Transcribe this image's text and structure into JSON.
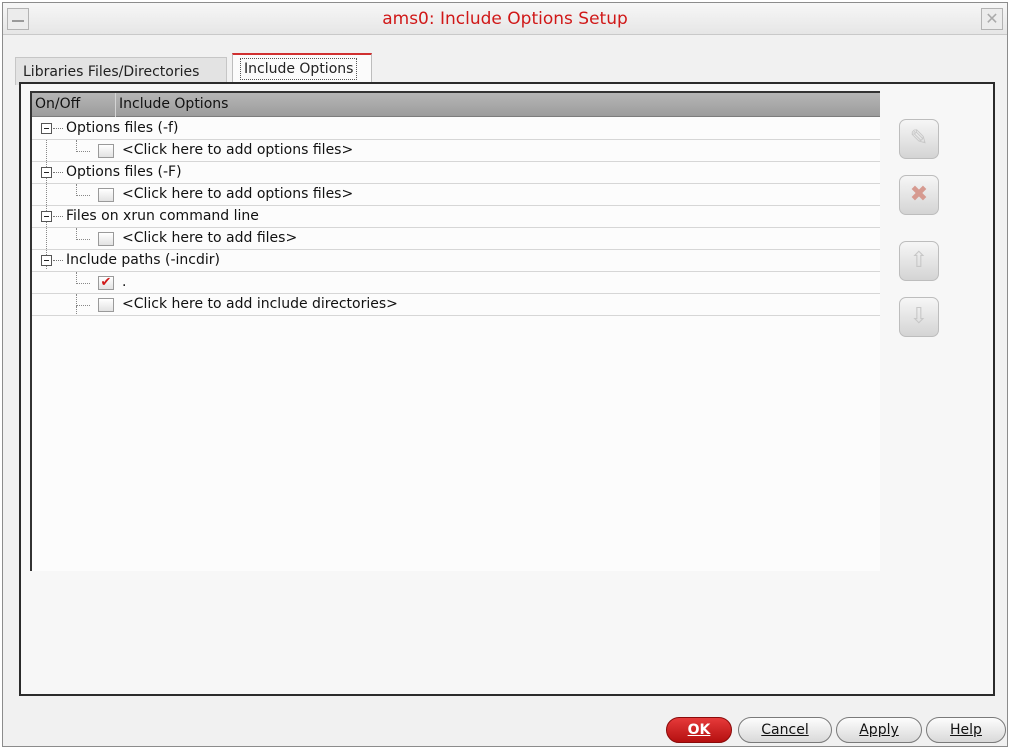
{
  "window": {
    "title": "ams0: Include Options Setup",
    "close_glyph": "✕"
  },
  "tabs": [
    {
      "label": "Libraries Files/Directories",
      "active": false
    },
    {
      "label": "Include Options",
      "active": true
    }
  ],
  "table": {
    "headers": [
      "On/Off",
      "Include Options"
    ],
    "groups": [
      {
        "label": "Options files (-f)",
        "children": [
          {
            "checked": false,
            "text": "<Click here to add options files>"
          }
        ]
      },
      {
        "label": "Options files (-F)",
        "children": [
          {
            "checked": false,
            "text": "<Click here to add options files>"
          }
        ]
      },
      {
        "label": "Files on xrun command line",
        "children": [
          {
            "checked": false,
            "text": "<Click here to add files>"
          }
        ]
      },
      {
        "label": "Include paths (-incdir)",
        "children": [
          {
            "checked": true,
            "text": "."
          },
          {
            "checked": false,
            "text": "<Click here to add include directories>"
          }
        ]
      }
    ]
  },
  "side_buttons": [
    {
      "icon": "edit-icon",
      "glyph": "✎"
    },
    {
      "icon": "delete-icon",
      "glyph": "✖"
    },
    {
      "icon": "move-up-icon",
      "glyph": "⇧"
    },
    {
      "icon": "move-down-icon",
      "glyph": "⇩"
    }
  ],
  "footer": {
    "ok": "OK",
    "cancel": "Cancel",
    "apply": "Apply",
    "help": "Help"
  },
  "colors": {
    "title": "#d01818",
    "ok_button": "#c81e1e",
    "checkmark": "#d01818"
  }
}
